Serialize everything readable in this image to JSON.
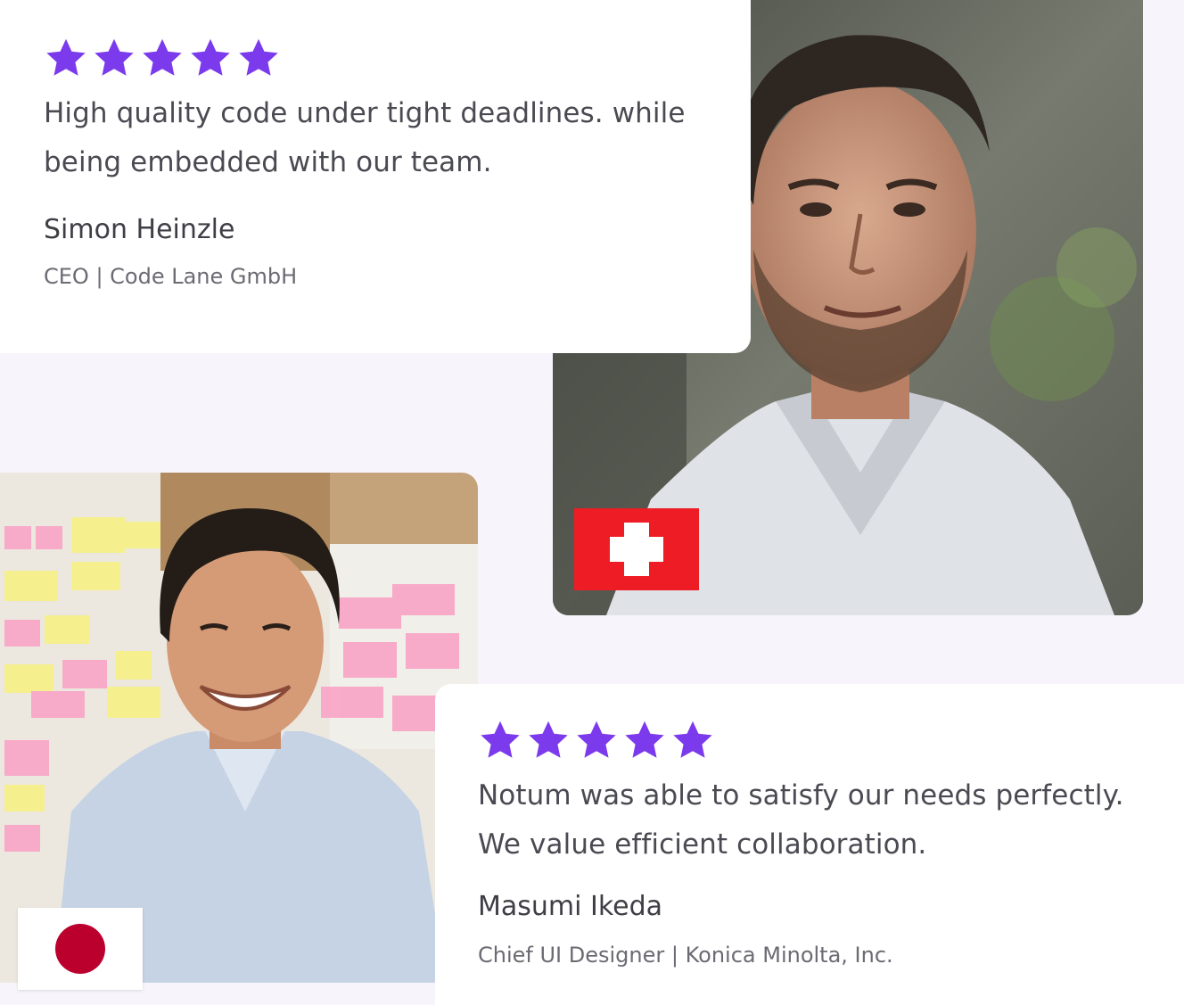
{
  "colors": {
    "star": "#7c3aed",
    "swiss_red": "#ee1c25",
    "japan_red": "#bc002d"
  },
  "testimonials": [
    {
      "rating": 5,
      "quote": "High quality code under tight deadlines. while being embedded with our team.",
      "author": "Simon Heinzle",
      "role": "CEO | Code Lane GmbH",
      "flag_icon": "switzerland-flag-icon"
    },
    {
      "rating": 5,
      "quote": "Notum was able to satisfy our needs perfectly. We value efficient collaboration.",
      "author": "Masumi Ikeda",
      "role": "Chief UI Designer | Konica Minolta, Inc.",
      "flag_icon": "japan-flag-icon"
    }
  ]
}
